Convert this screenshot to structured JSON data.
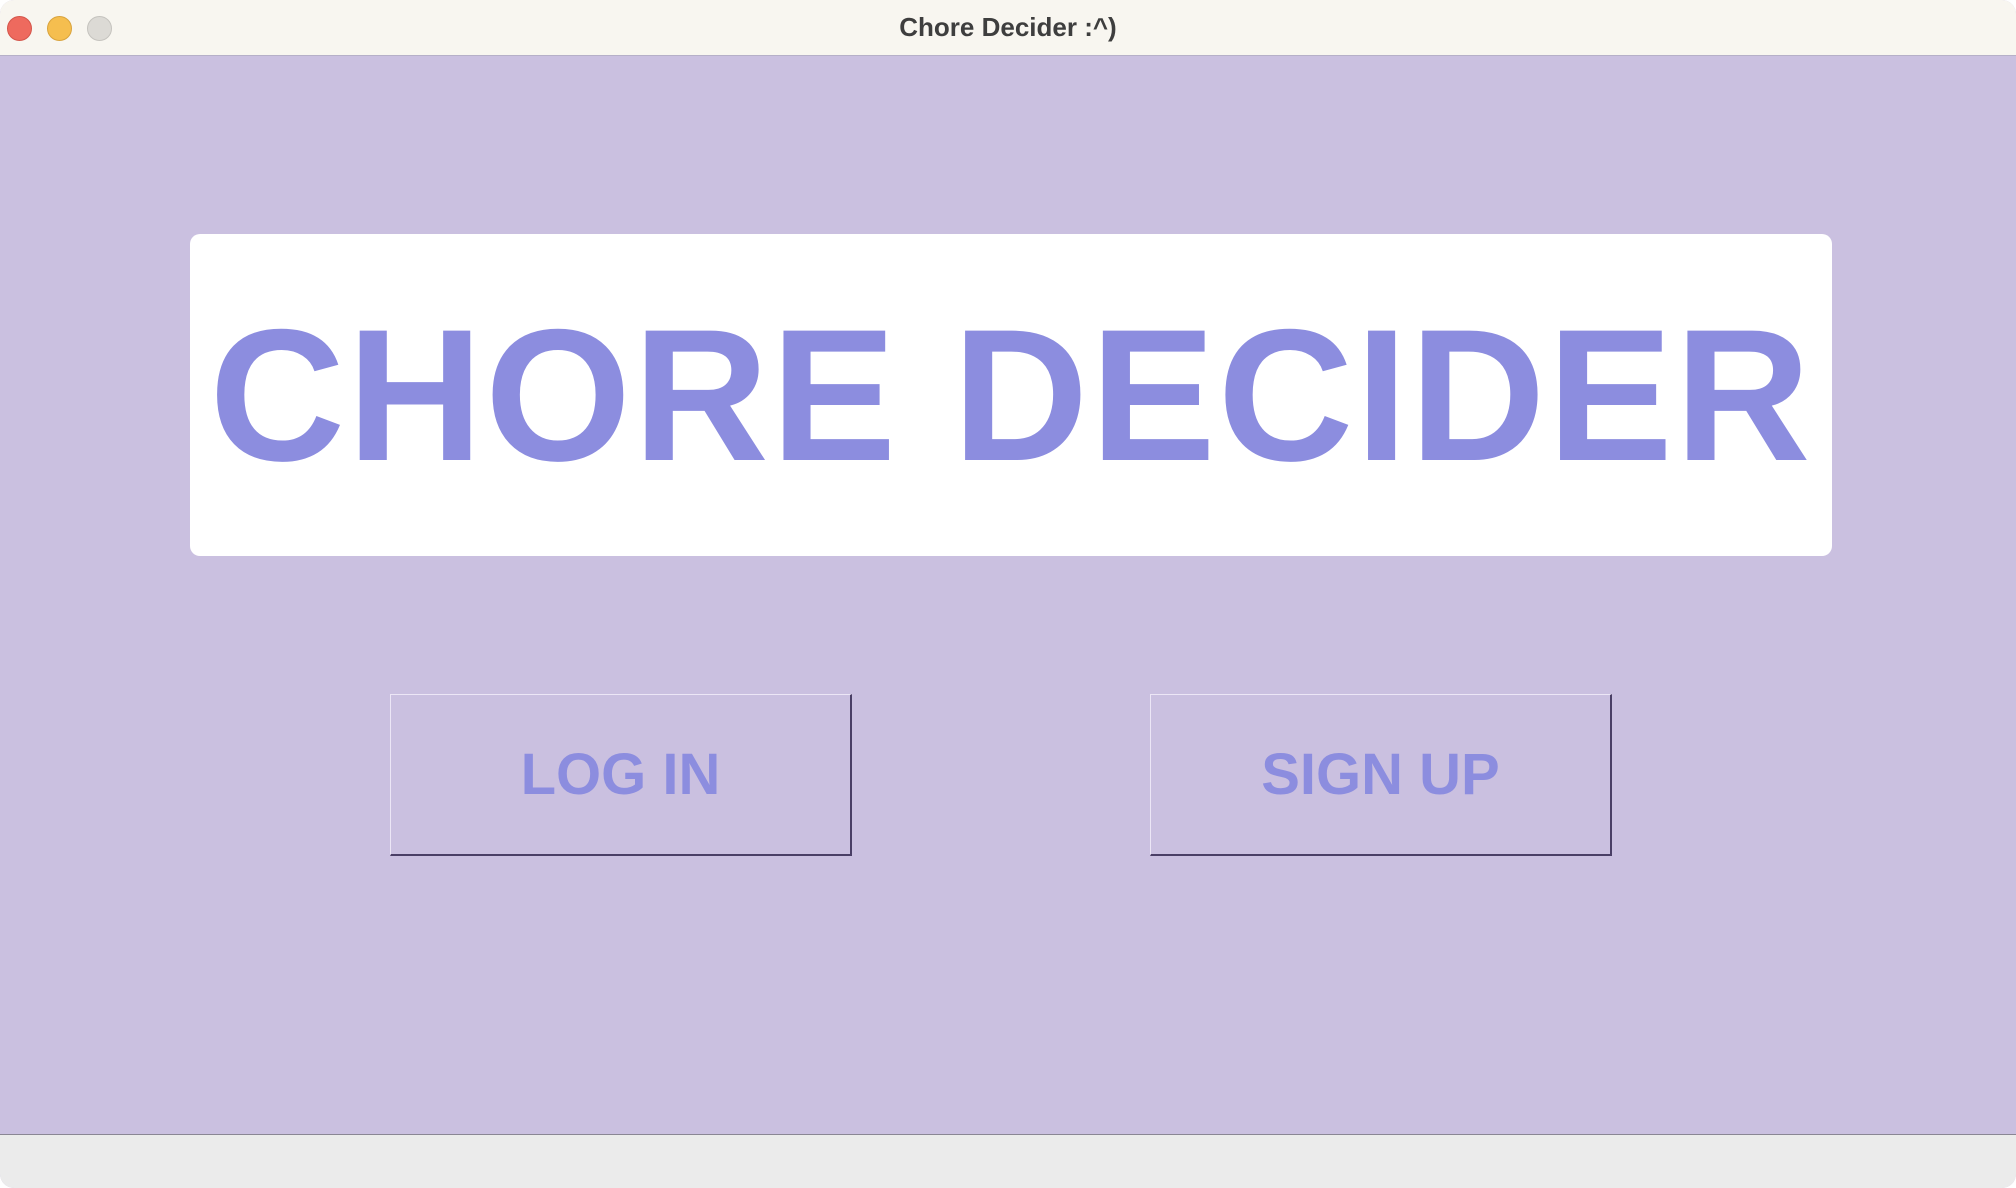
{
  "window": {
    "title": "Chore Decider :^)"
  },
  "banner": {
    "text": "CHORE DECIDER"
  },
  "buttons": {
    "login_label": "LOG IN",
    "signup_label": "SIGN UP"
  },
  "colors": {
    "background": "#cac0e0",
    "accent": "#8c8ddf",
    "banner_bg": "#ffffff",
    "titlebar_bg": "#f8f6f0"
  },
  "icons": {
    "close": "close-traffic-light",
    "minimize": "minimize-traffic-light",
    "maximize": "maximize-traffic-light"
  }
}
